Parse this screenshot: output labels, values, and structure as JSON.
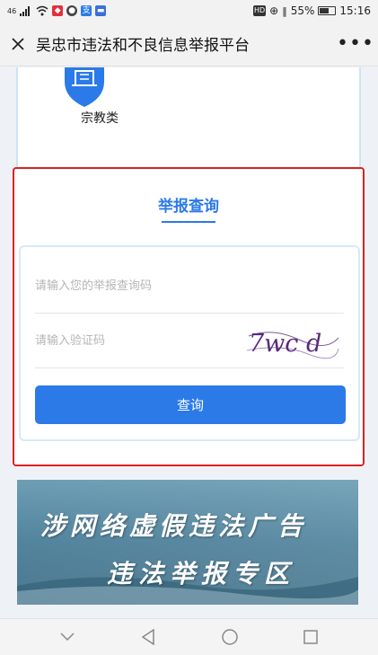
{
  "status_bar": {
    "network": "46",
    "battery": "55%",
    "time": "15:16"
  },
  "title_bar": {
    "close_icon": "close-icon",
    "title": "吴忠市违法和不良信息举报平台",
    "more_label": "•••"
  },
  "category": {
    "label": "宗教类",
    "icon": "shield-building-icon"
  },
  "query": {
    "title": "举报查询",
    "code_placeholder": "请输入您的举报查询码",
    "captcha_placeholder": "请输入验证码",
    "captcha_text": "7wc d",
    "submit_label": "查询"
  },
  "banner": {
    "line1": "涉网络虚假违法广告",
    "line2": "违法举报专区"
  },
  "colors": {
    "accent": "#2b7ae8",
    "highlight_border": "#e02020",
    "captcha_text": "#5a2a7a"
  }
}
